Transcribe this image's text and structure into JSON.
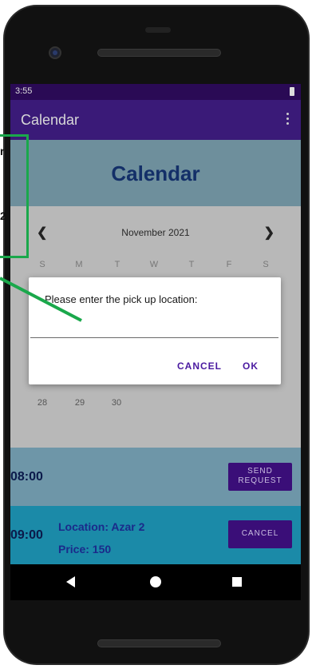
{
  "status_bar": {
    "time": "3:55"
  },
  "app_bar": {
    "title": "Calendar",
    "menu_icon": "overflow-menu-icon"
  },
  "header": {
    "title": "Calendar"
  },
  "calendar": {
    "month": "November 2021",
    "weekdays": [
      "S",
      "M",
      "T",
      "W",
      "T",
      "F",
      "S"
    ],
    "visible_days": [
      "28",
      "29",
      "30"
    ]
  },
  "dialog": {
    "message": "Please enter the pick up location:",
    "input_value": "",
    "cancel_label": "CANCEL",
    "ok_label": "OK"
  },
  "slots": [
    {
      "time": "08:00",
      "button_label": "SEND\nREQUEST"
    },
    {
      "time": "09:00",
      "location": "Location: Azar 2",
      "price": "Price: 150",
      "button_label": "CANCEL"
    }
  ],
  "annotation": {
    "fragment_top": "r",
    "fragment_bottom": "2"
  },
  "colors": {
    "app_bar": "#3a1a78",
    "header_title": "#132f68",
    "accent_button": "#3a0e78",
    "dialog_action": "#4a1aa0",
    "annotation_green": "#1aa84b"
  }
}
